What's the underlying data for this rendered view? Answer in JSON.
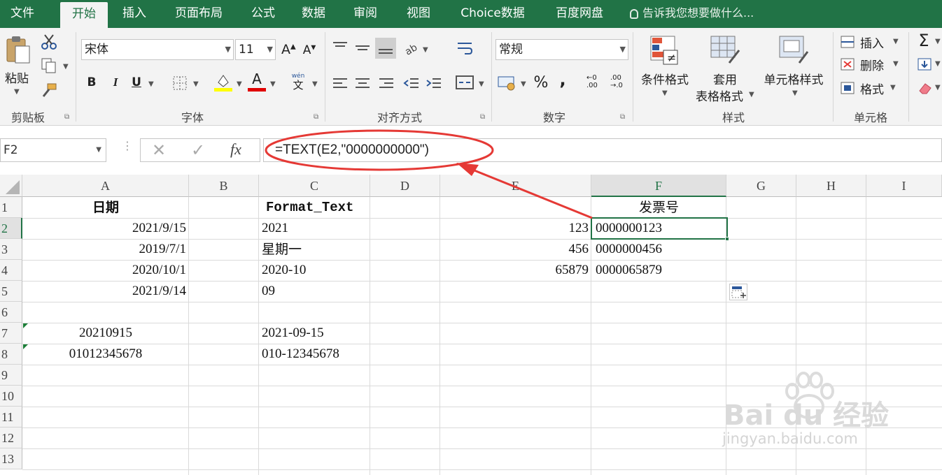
{
  "tabs": [
    "文件",
    "开始",
    "插入",
    "页面布局",
    "公式",
    "数据",
    "审阅",
    "视图",
    "Choice数据",
    "百度网盘"
  ],
  "active_tab": "开始",
  "tell_me": "告诉我您想要做什么...",
  "ribbon": {
    "clipboard": {
      "paste": "粘贴",
      "label": "剪贴板"
    },
    "font": {
      "name": "宋体",
      "size": "11",
      "label": "字体",
      "bold": "B",
      "italic": "I",
      "underline": "U",
      "wen": "wén",
      "wen_char": "文"
    },
    "alignment": {
      "label": "对齐方式"
    },
    "number": {
      "format": "常规",
      "label": "数字",
      "percent": "%",
      "comma": ","
    },
    "styles": {
      "conditional": "条件格式",
      "table_fmt_1": "套用",
      "table_fmt_2": "表格格式",
      "cell_styles": "单元格样式",
      "label": "样式"
    },
    "cells": {
      "insert": "插入",
      "delete": "删除",
      "format": "格式",
      "label": "单元格"
    },
    "colors": {
      "fill": "#ffff00",
      "font": "#e00000"
    }
  },
  "formula_bar": {
    "name_box": "F2",
    "formula": "=TEXT(E2,\"0000000000\")"
  },
  "sheet": {
    "columns": [
      "A",
      "B",
      "C",
      "D",
      "E",
      "F",
      "G",
      "H",
      "I"
    ],
    "rows": [
      "1",
      "2",
      "3",
      "4",
      "5",
      "6",
      "7",
      "8",
      "9",
      "10",
      "11",
      "12",
      "13"
    ],
    "selected_cell": "F2",
    "cells": {
      "A1": "日期",
      "C1": "Format_Text",
      "F1": "发票号",
      "A2": "2021/9/15",
      "C2": "2021",
      "E2": "123",
      "F2": "0000000123",
      "A3": "2019/7/1",
      "C3": "星期一",
      "E3": "456",
      "F3": "0000000456",
      "A4": "2020/10/1",
      "C4": "2020-10",
      "E4": "65879",
      "F4": "0000065879",
      "A5": "2021/9/14",
      "C5": "09",
      "A7": "20210915",
      "C7": "2021-09-15",
      "A8": "01012345678",
      "C8": "010-12345678"
    }
  },
  "annotation_color": "#e53935",
  "watermark": {
    "brand": "Bai du 经验",
    "url": "jingyan.baidu.com"
  }
}
